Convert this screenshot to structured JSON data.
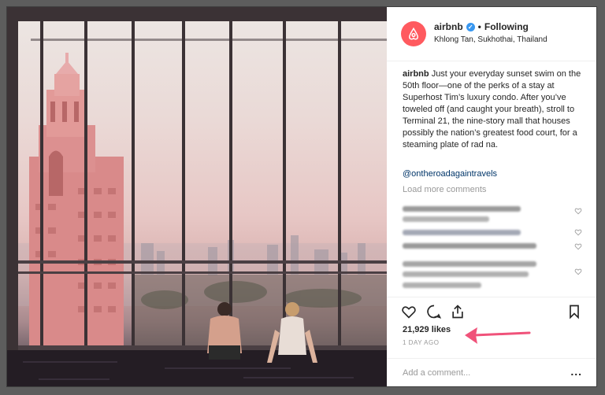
{
  "post": {
    "username": "airbnb",
    "verified_icon": "verified-badge-icon",
    "separator": "•",
    "follow_status": "Following",
    "location": "Khlong Tan, Sukhothai, Thailand",
    "caption_user": "airbnb",
    "caption_text": "Just your everyday sunset swim on the 50th floor—one of the perks of a stay at Superhost Tim’s luxury condo. After you’ve toweled off (and caught your breath), stroll to Terminal 21, the nine-story mall that houses possibly the nation’s greatest food court, for a steaming plate of rad na.",
    "mention": "@ontheroadagaintravels",
    "load_more": "Load more comments",
    "likes": "21,929 likes",
    "time": "1 DAY AGO",
    "comment_placeholder": "Add a comment...",
    "more_label": "..."
  },
  "icons": {
    "avatar": "airbnb-logo-icon",
    "like": "heart-icon",
    "comment": "comment-icon",
    "share": "share-icon",
    "save": "bookmark-icon",
    "annotation": "arrow-icon"
  },
  "colors": {
    "brand": "#ff5a5f",
    "verified": "#3897f0",
    "arrow": "#f0527a"
  }
}
